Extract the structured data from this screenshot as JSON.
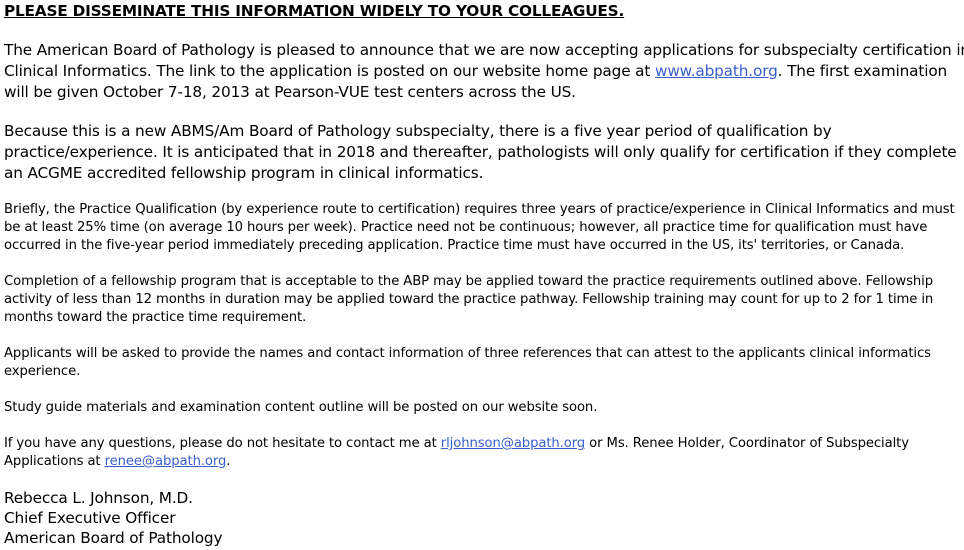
{
  "heading": "PLEASE DISSEMINATE THIS INFORMATION WIDELY TO YOUR COLLEAGUES.",
  "p1": {
    "l1": "The American Board of Pathology is pleased to announce that we are now accepting applications for subspecialty certification in",
    "l2_pre": "Clinical Informatics.  The link to the application is posted on our website home page at ",
    "l2_link": "www.abpath.org",
    "l2_post": ".  The first examination",
    "l3": "will be given October 7-18, 2013 at Pearson-VUE test centers across the US."
  },
  "p2": {
    "l1": "Because this is a new ABMS/Am Board of Pathology subspecialty, there is a five year period of qualification by",
    "l2": "practice/experience.  It is anticipated that in 2018 and thereafter, pathologists will only qualify for certification if they complete",
    "l3": "an ACGME accredited fellowship program in clinical informatics."
  },
  "p3": {
    "l1": "Briefly, the Practice Qualification (by experience route to certification) requires three years of practice/experience in Clinical Informatics and must",
    "l2": "be at least 25% time (on average 10 hours per week).  Practice need not be continuous; however, all practice time for qualification must have",
    "l3": "occurred in the five-year period immediately preceding application.  Practice time must have occurred in the US, its' territories, or Canada."
  },
  "p4": {
    "l1": "Completion of a fellowship program that is acceptable to the ABP may be applied toward the practice requirements outlined above.  Fellowship",
    "l2": "activity of less than 12 months in duration may be applied toward the practice pathway.  Fellowship training may count for up to 2 for 1 time in",
    "l3": "months toward the practice time requirement."
  },
  "p5": {
    "l1": "Applicants will be asked to provide the names and contact information of three references that can attest to the applicants clinical informatics",
    "l2": "experience."
  },
  "p6": "Study guide materials and examination content outline will be posted on our website soon.",
  "p7": {
    "l1_pre": "If you have any questions, please do not hesitate to contact me at ",
    "l1_link": "rljohnson@abpath.org",
    "l1_post": " or Ms. Renee Holder, Coordinator of Subspecialty",
    "l2_pre": "Applications at ",
    "l2_link": "renee@abpath.org",
    "l2_post": "."
  },
  "signature": {
    "name": "Rebecca L. Johnson, M.D.",
    "title": "Chief Executive Officer",
    "org": "American Board of Pathology"
  },
  "colors": {
    "link": "#3a5fcd",
    "text": "#000000"
  }
}
